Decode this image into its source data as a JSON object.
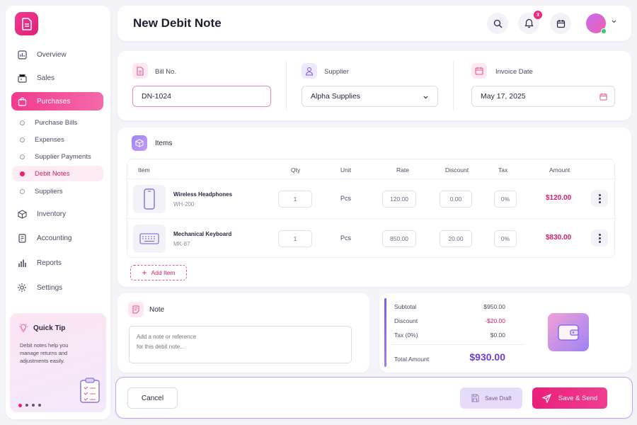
{
  "header": {
    "title": "New Debit Note",
    "notif_count": "3"
  },
  "sidebar": {
    "items": [
      {
        "label": "Overview",
        "icon": "chart-icon"
      },
      {
        "label": "Sales",
        "icon": "register-icon"
      },
      {
        "label": "Purchases",
        "icon": "bag-icon",
        "active": true
      },
      {
        "label": "Inventory",
        "icon": "box-icon"
      },
      {
        "label": "Accounting",
        "icon": "ledger-icon"
      },
      {
        "label": "Reports",
        "icon": "bars-icon"
      },
      {
        "label": "Settings",
        "icon": "gear-icon"
      }
    ],
    "sub_items": [
      {
        "label": "Purchase Bills"
      },
      {
        "label": "Expenses"
      },
      {
        "label": "Supplier Payments"
      },
      {
        "label": "Debit Notes",
        "active": true
      },
      {
        "label": "Suppliers"
      }
    ],
    "tip": {
      "title": "Quick Tip",
      "text": "Debit notes help you manage returns and adjustments easily."
    }
  },
  "fields": {
    "bill_no": {
      "label": "Bill No.",
      "value": "DN-1024"
    },
    "supplier": {
      "label": "Supplier",
      "value": "Alpha Supplies"
    },
    "invoice_date": {
      "label": "Invoice Date",
      "value": "May 17, 2025"
    }
  },
  "items": {
    "title": "Items",
    "columns": [
      "Item",
      "Qty",
      "Unit",
      "Rate",
      "Discount",
      "Tax",
      "Amount"
    ],
    "rows": [
      {
        "name": "Wireless Headphones",
        "sku": "WH-200",
        "qty": "1",
        "unit": "Pcs",
        "rate": "120.00",
        "discount": "0.00",
        "tax": "0%",
        "amount": "$120.00"
      },
      {
        "name": "Mechanical Keyboard",
        "sku": "MK-87",
        "qty": "1",
        "unit": "Pcs",
        "rate": "850.00",
        "discount": "20.00",
        "tax": "0%",
        "amount": "$830.00"
      }
    ],
    "add_label": "Add Item"
  },
  "note": {
    "title": "Note",
    "placeholder": "Add a note or reference\nfor this debit note..."
  },
  "summary": {
    "subtotal_label": "Subtotal",
    "subtotal": "$950.00",
    "discount_label": "Discount",
    "discount": "-$20.00",
    "tax_label": "Tax (0%)",
    "tax": "$0.00",
    "total_label": "Total Amount",
    "total": "$930.00"
  },
  "footer": {
    "cancel": "Cancel",
    "save_draft": "Save Draft",
    "save_send": "Save & Send"
  },
  "colors": {
    "accent": "#ea1f7a",
    "purple": "#7b5cf0"
  }
}
